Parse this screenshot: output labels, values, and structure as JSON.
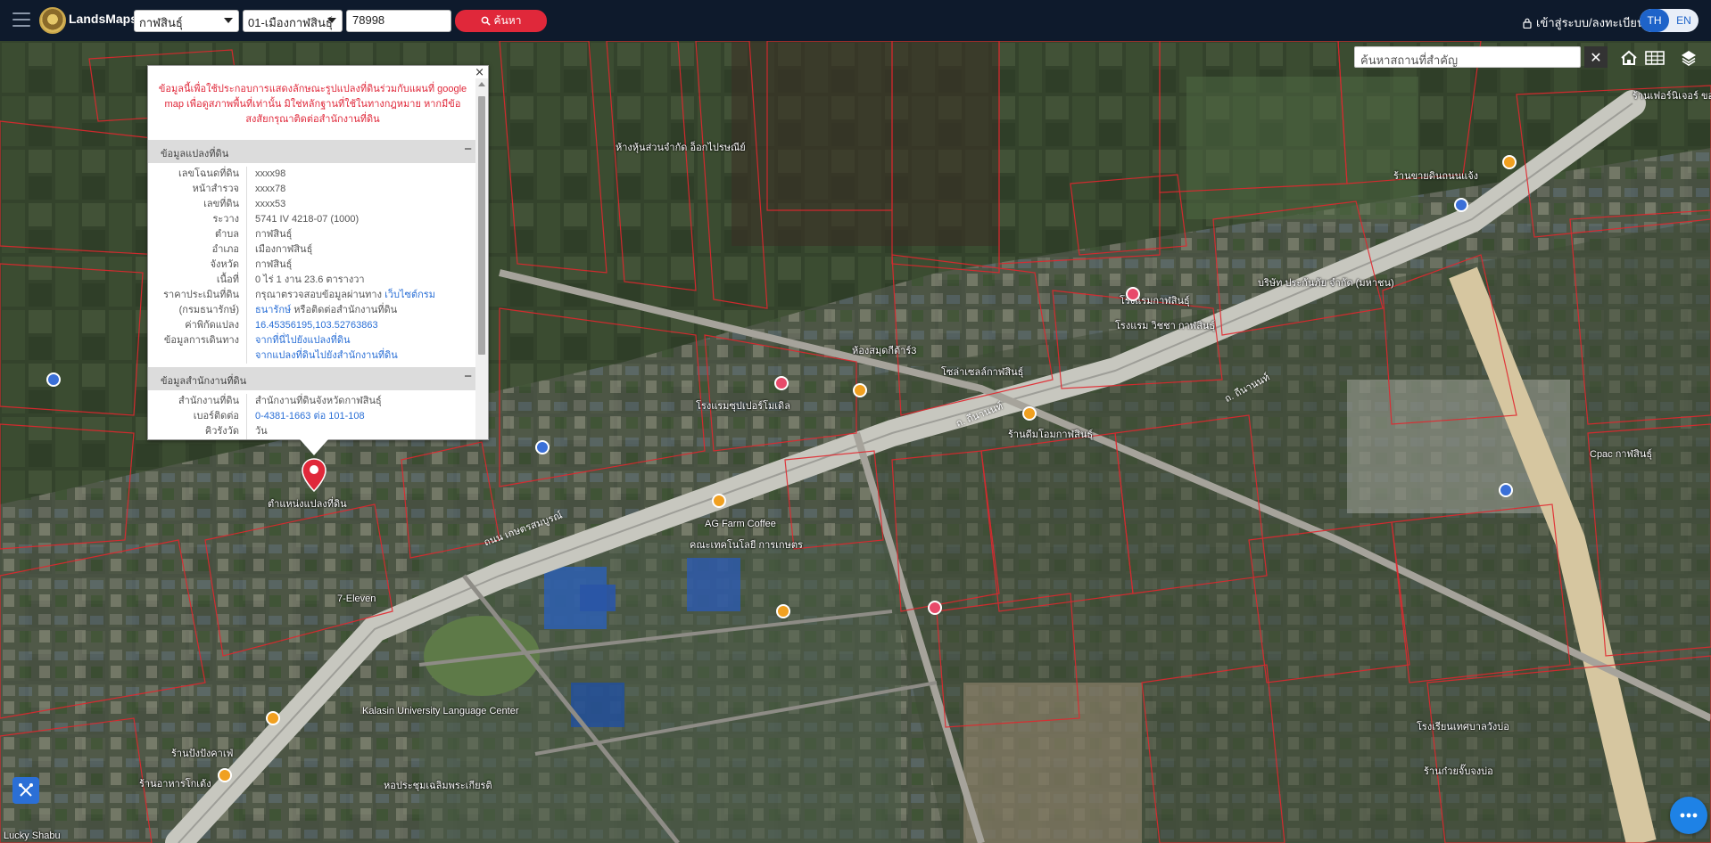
{
  "app": {
    "brand": "LandsMaps"
  },
  "search": {
    "province": "กาฬสินธุ์",
    "district": "01-เมืองกาฬสินธุ์",
    "parcel_no": "78998",
    "button_label": "ค้นหา"
  },
  "header": {
    "login_label": "เข้าสู่ระบบ/ลงทะเบียน",
    "lang_th": "TH",
    "lang_en": "EN"
  },
  "map_tools": {
    "place_search_placeholder": "ค้นหาสถานที่สำคัญ",
    "close_symbol": "✕",
    "icons": [
      "home-icon",
      "grid-icon",
      "layers-icon"
    ]
  },
  "popup": {
    "close_symbol": "×",
    "disclaimer": "ข้อมูลนี้เพื่อใช้ประกอบการแสดงลักษณะรูปแปลงที่ดินร่วมกับแผนที่ google map เพื่อดูสภาพพื้นที่เท่านั้น มิใช่หลักฐานที่ใช้ในทางกฎหมาย หากมีข้อสงสัยกรุณาติดต่อสำนักงานที่ดิน",
    "land_section": {
      "title": "ข้อมูลแปลงที่ดิน",
      "collapse_symbol": "−",
      "rows": [
        {
          "k": "เลขโฉนดที่ดิน",
          "v": "xxxx98"
        },
        {
          "k": "หน้าสำรวจ",
          "v": "xxxx78"
        },
        {
          "k": "เลขที่ดิน",
          "v": "xxxx53"
        },
        {
          "k": "ระวาง",
          "v": "5741 IV 4218-07 (1000)"
        },
        {
          "k": "ตำบล",
          "v": "กาฬสินธุ์"
        },
        {
          "k": "อำเภอ",
          "v": "เมืองกาฬสินธุ์"
        },
        {
          "k": "จังหวัด",
          "v": "กาฬสินธุ์"
        },
        {
          "k": "เนื้อที่",
          "v": "0 ไร่ 1 งาน 23.6 ตารางวา"
        },
        {
          "k": "ราคาประเมินที่ดิน",
          "v": "กรุณาตรวจสอบข้อมูลผ่านทาง",
          "link": "เว็บไซต์กรม"
        },
        {
          "k": "(กรมธนารักษ์)",
          "link2": "ธนารักษ์",
          "v2": " หรือติดต่อสำนักงานที่ดิน"
        },
        {
          "k": "ค่าพิกัดแปลง",
          "link": "16.45356195,103.52763863"
        },
        {
          "k": "ข้อมูลการเดินทาง",
          "link": "จากที่นี่ไปยังแปลงที่ดิน"
        },
        {
          "k": "",
          "link": "จากแปลงที่ดินไปยังสำนักงานที่ดิน"
        }
      ]
    },
    "office_section": {
      "title": "ข้อมูลสำนักงานที่ดิน",
      "collapse_symbol": "−",
      "rows": [
        {
          "k": "สำนักงานที่ดิน",
          "v": "สำนักงานที่ดินจังหวัดกาฬสินธุ์"
        },
        {
          "k": "เบอร์ติดต่อ",
          "link": "0-4381-1663 ต่อ 101-108"
        },
        {
          "k": "คิวรังวัด",
          "v": "วัน"
        }
      ]
    }
  },
  "marker": {
    "label": "ตำแหน่งแปลงที่ดิน"
  },
  "map_labels": {
    "pois": [
      "ห้างหุ้นส่วนจำกัด อ็อกไปรษณีย์",
      "ร้านขายดินถนนแจ้ง",
      "ร้านเฟอร์นิเจอร์ ขอนแก่น",
      "บริษัท ประกันภัย จำกัด (มหาชน)",
      "โรงแรมกาฬสินธุ์",
      "โรงแรม วิชชา กาฬสินธุ์",
      "ห้องสมุดกีต้าร์3",
      "โซล่าเซลล์กาฬสินธุ์",
      "โรงแรมซุปเปอร์โมเดิล",
      "ร้านดีมโอมกาฬสินธุ์",
      "Cpac กาฬสินธุ์",
      "AG Farm Coffee",
      "คณะเทคโนโลยี การเกษตร",
      "7-Eleven",
      "Kalasin University Language Center",
      "ร้านปังปังคาเฟ่",
      "ร้านอาหารโกเต้ง",
      "ร้านก๋วยจั๊บจงบ่อ",
      "Lucky Shabu",
      "หอประชุมเฉลิมพระเกียรติ",
      "โรงเรียนเทศบาลวังบ่อ"
    ],
    "roads": [
      "ถ. ถีนานนท์",
      "ถนน เกษตรสมบูรณ์",
      "ถ. ถีนานนท์"
    ]
  }
}
